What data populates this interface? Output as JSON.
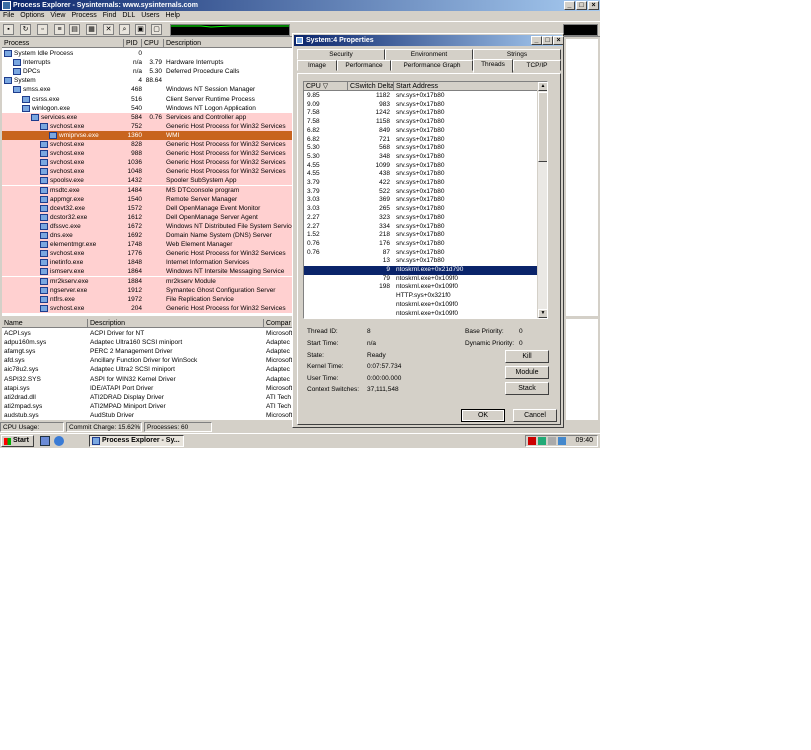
{
  "app": {
    "title": "Process Explorer - Sysinternals: www.sysinternals.com"
  },
  "menu": [
    "File",
    "Options",
    "View",
    "Process",
    "Find",
    "DLL",
    "Users",
    "Help"
  ],
  "proc_headers": [
    "Process",
    "PID",
    "CPU",
    "Description"
  ],
  "processes": [
    {
      "name": "System Idle Process",
      "pid": "0",
      "cpu": "",
      "desc": "",
      "indent": 0,
      "hl": ""
    },
    {
      "name": "Interrupts",
      "pid": "n/a",
      "cpu": "3.79",
      "desc": "Hardware Interrupts",
      "indent": 1,
      "hl": ""
    },
    {
      "name": "DPCs",
      "pid": "n/a",
      "cpu": "5.30",
      "desc": "Deferred Procedure Calls",
      "indent": 1,
      "hl": ""
    },
    {
      "name": "System",
      "pid": "4",
      "cpu": "88.64",
      "desc": "",
      "indent": 0,
      "hl": ""
    },
    {
      "name": "smss.exe",
      "pid": "468",
      "cpu": "",
      "desc": "Windows NT Session Manager",
      "indent": 1,
      "hl": ""
    },
    {
      "name": "csrss.exe",
      "pid": "516",
      "cpu": "",
      "desc": "Client Server Runtime Process",
      "indent": 2,
      "hl": ""
    },
    {
      "name": "winlogon.exe",
      "pid": "540",
      "cpu": "",
      "desc": "Windows NT Logon Application",
      "indent": 2,
      "hl": ""
    },
    {
      "name": "services.exe",
      "pid": "584",
      "cpu": "0.76",
      "desc": "Services and Controller app",
      "indent": 3,
      "hl": "pink"
    },
    {
      "name": "svchost.exe",
      "pid": "752",
      "cpu": "",
      "desc": "Generic Host Process for Win32 Services",
      "indent": 4,
      "hl": "pink"
    },
    {
      "name": "wmiprvse.exe",
      "pid": "1360",
      "cpu": "",
      "desc": "WMI",
      "indent": 5,
      "hl": "orange"
    },
    {
      "name": "svchost.exe",
      "pid": "828",
      "cpu": "",
      "desc": "Generic Host Process for Win32 Services",
      "indent": 4,
      "hl": "pink"
    },
    {
      "name": "svchost.exe",
      "pid": "988",
      "cpu": "",
      "desc": "Generic Host Process for Win32 Services",
      "indent": 4,
      "hl": "pink"
    },
    {
      "name": "svchost.exe",
      "pid": "1036",
      "cpu": "",
      "desc": "Generic Host Process for Win32 Services",
      "indent": 4,
      "hl": "pink"
    },
    {
      "name": "svchost.exe",
      "pid": "1048",
      "cpu": "",
      "desc": "Generic Host Process for Win32 Services",
      "indent": 4,
      "hl": "pink"
    },
    {
      "name": "spoolsv.exe",
      "pid": "1432",
      "cpu": "",
      "desc": "Spooler SubSystem App",
      "indent": 4,
      "hl": "pink"
    },
    {
      "name": "msdtc.exe",
      "pid": "1484",
      "cpu": "",
      "desc": "MS DTCconsole program",
      "indent": 4,
      "hl": "pink"
    },
    {
      "name": "appmgr.exe",
      "pid": "1540",
      "cpu": "",
      "desc": "Remote Server Manager",
      "indent": 4,
      "hl": "pink"
    },
    {
      "name": "dcevt32.exe",
      "pid": "1572",
      "cpu": "",
      "desc": "Dell OpenManage Event Monitor",
      "indent": 4,
      "hl": "pink"
    },
    {
      "name": "dcstor32.exe",
      "pid": "1612",
      "cpu": "",
      "desc": "Dell OpenManage Server Agent",
      "indent": 4,
      "hl": "pink"
    },
    {
      "name": "dfssvc.exe",
      "pid": "1672",
      "cpu": "",
      "desc": "Windows NT Distributed File System Service",
      "indent": 4,
      "hl": "pink"
    },
    {
      "name": "dns.exe",
      "pid": "1692",
      "cpu": "",
      "desc": "Domain Name System (DNS) Server",
      "indent": 4,
      "hl": "pink"
    },
    {
      "name": "elementmgr.exe",
      "pid": "1748",
      "cpu": "",
      "desc": "Web Element Manager",
      "indent": 4,
      "hl": "pink"
    },
    {
      "name": "svchost.exe",
      "pid": "1776",
      "cpu": "",
      "desc": "Generic Host Process for Win32 Services",
      "indent": 4,
      "hl": "pink"
    },
    {
      "name": "inetinfo.exe",
      "pid": "1848",
      "cpu": "",
      "desc": "Internet Information Services",
      "indent": 4,
      "hl": "pink"
    },
    {
      "name": "ismserv.exe",
      "pid": "1864",
      "cpu": "",
      "desc": "Windows NT Intersite Messaging Service",
      "indent": 4,
      "hl": "pink"
    },
    {
      "name": "mr2kserv.exe",
      "pid": "1884",
      "cpu": "",
      "desc": "mr2kserv Module",
      "indent": 4,
      "hl": "pink"
    },
    {
      "name": "ngserver.exe",
      "pid": "1912",
      "cpu": "",
      "desc": "Symantec Ghost Configuration Server",
      "indent": 4,
      "hl": "pink"
    },
    {
      "name": "ntfrs.exe",
      "pid": "1972",
      "cpu": "",
      "desc": "File Replication Service",
      "indent": 4,
      "hl": "pink"
    },
    {
      "name": "svchost.exe",
      "pid": "204",
      "cpu": "",
      "desc": "Generic Host Process for Win32 Services",
      "indent": 4,
      "hl": "pink"
    }
  ],
  "dll_headers": [
    "Name",
    "Description",
    "Compar"
  ],
  "dlls": [
    {
      "name": "ACPI.sys",
      "desc": "ACPI Driver for NT",
      "co": "Microsoft"
    },
    {
      "name": "adpu160m.sys",
      "desc": "Adaptec Ultra160 SCSI miniport",
      "co": "Adaptec"
    },
    {
      "name": "afamgt.sys",
      "desc": "PERC 2 Management Driver",
      "co": "Adaptec"
    },
    {
      "name": "afd.sys",
      "desc": "Ancillary Function Driver for WinSock",
      "co": "Microsoft"
    },
    {
      "name": "aic78u2.sys",
      "desc": "Adaptec Ultra2 SCSI miniport",
      "co": "Adaptec"
    },
    {
      "name": "ASPI32.SYS",
      "desc": "ASPI for WIN32 Kernel Driver",
      "co": "Adaptec"
    },
    {
      "name": "atapi.sys",
      "desc": "IDE/ATAPI Port Driver",
      "co": "Microsoft"
    },
    {
      "name": "ati2drad.dll",
      "desc": "ATI2DRAD Display Driver",
      "co": "ATI Tech"
    },
    {
      "name": "ati2mpad.sys",
      "desc": "ATI2MPAD Miniport Driver",
      "co": "ATI Tech"
    },
    {
      "name": "audstub.sys",
      "desc": "AudStub Driver",
      "co": "Microsoft"
    }
  ],
  "status": {
    "cpu": "CPU Usage: 100.00%",
    "commit": "Commit Charge: 15.62%",
    "procs": "Processes: 60"
  },
  "taskbar": {
    "start": "Start",
    "task": "Process Explorer - Sy...",
    "clock": "09:40"
  },
  "dialog": {
    "title": "System:4 Properties",
    "tabs_row1": [
      "Security",
      "Environment",
      "Strings"
    ],
    "tabs_row2": [
      "Image",
      "Performance",
      "Performance Graph",
      "Threads",
      "TCP/IP"
    ],
    "thread_headers": [
      "CPU",
      "CSwitch Delta",
      "Start Address"
    ],
    "threads": [
      {
        "cpu": "9.85",
        "cs": "1182",
        "addr": "srv.sys+0x17b80"
      },
      {
        "cpu": "9.09",
        "cs": "983",
        "addr": "srv.sys+0x17b80"
      },
      {
        "cpu": "7.58",
        "cs": "1242",
        "addr": "srv.sys+0x17b80"
      },
      {
        "cpu": "7.58",
        "cs": "1158",
        "addr": "srv.sys+0x17b80"
      },
      {
        "cpu": "6.82",
        "cs": "849",
        "addr": "srv.sys+0x17b80"
      },
      {
        "cpu": "6.82",
        "cs": "721",
        "addr": "srv.sys+0x17b80"
      },
      {
        "cpu": "5.30",
        "cs": "568",
        "addr": "srv.sys+0x17b80"
      },
      {
        "cpu": "5.30",
        "cs": "348",
        "addr": "srv.sys+0x17b80"
      },
      {
        "cpu": "4.55",
        "cs": "1099",
        "addr": "srv.sys+0x17b80"
      },
      {
        "cpu": "4.55",
        "cs": "438",
        "addr": "srv.sys+0x17b80"
      },
      {
        "cpu": "3.79",
        "cs": "422",
        "addr": "srv.sys+0x17b80"
      },
      {
        "cpu": "3.79",
        "cs": "522",
        "addr": "srv.sys+0x17b80"
      },
      {
        "cpu": "3.03",
        "cs": "369",
        "addr": "srv.sys+0x17b80"
      },
      {
        "cpu": "3.03",
        "cs": "265",
        "addr": "srv.sys+0x17b80"
      },
      {
        "cpu": "2.27",
        "cs": "323",
        "addr": "srv.sys+0x17b80"
      },
      {
        "cpu": "2.27",
        "cs": "334",
        "addr": "srv.sys+0x17b80"
      },
      {
        "cpu": "1.52",
        "cs": "218",
        "addr": "srv.sys+0x17b80"
      },
      {
        "cpu": "0.76",
        "cs": "176",
        "addr": "srv.sys+0x17b80"
      },
      {
        "cpu": "0.76",
        "cs": "87",
        "addr": "srv.sys+0x17b80"
      },
      {
        "cpu": "",
        "cs": "13",
        "addr": "srv.sys+0x17b80"
      },
      {
        "cpu": "",
        "cs": "9",
        "addr": "ntoskrnl.exe+0x21d790"
      },
      {
        "cpu": "",
        "cs": "79",
        "addr": "ntoskrnl.exe+0x109f0"
      },
      {
        "cpu": "",
        "cs": "198",
        "addr": "ntoskrnl.exe+0x109f0"
      },
      {
        "cpu": "",
        "cs": "",
        "addr": "HTTP.sys+0x321f0"
      },
      {
        "cpu": "",
        "cs": "",
        "addr": "ntoskrnl.exe+0x109f0"
      },
      {
        "cpu": "",
        "cs": "",
        "addr": "ntoskrnl.exe+0x109f0"
      }
    ],
    "info": {
      "thread_id_label": "Thread ID:",
      "thread_id": "8",
      "start_time_label": "Start Time:",
      "start_time": "n/a",
      "state_label": "State:",
      "state": "Ready",
      "kernel_label": "Kernel Time:",
      "kernel": "0:07:57.734",
      "user_label": "User Time:",
      "user": "0:00:00.000",
      "ctx_label": "Context Switches:",
      "ctx": "37,111,548",
      "base_label": "Base Priority:",
      "base": "0",
      "dyn_label": "Dynamic Priority:",
      "dyn": "0"
    },
    "buttons": {
      "kill": "Kill",
      "module": "Module",
      "stack": "Stack",
      "ok": "OK",
      "cancel": "Cancel"
    }
  },
  "colors": {
    "pink": "#ffd0d0",
    "orange": "#c8641e",
    "selection": "#0a246a"
  }
}
